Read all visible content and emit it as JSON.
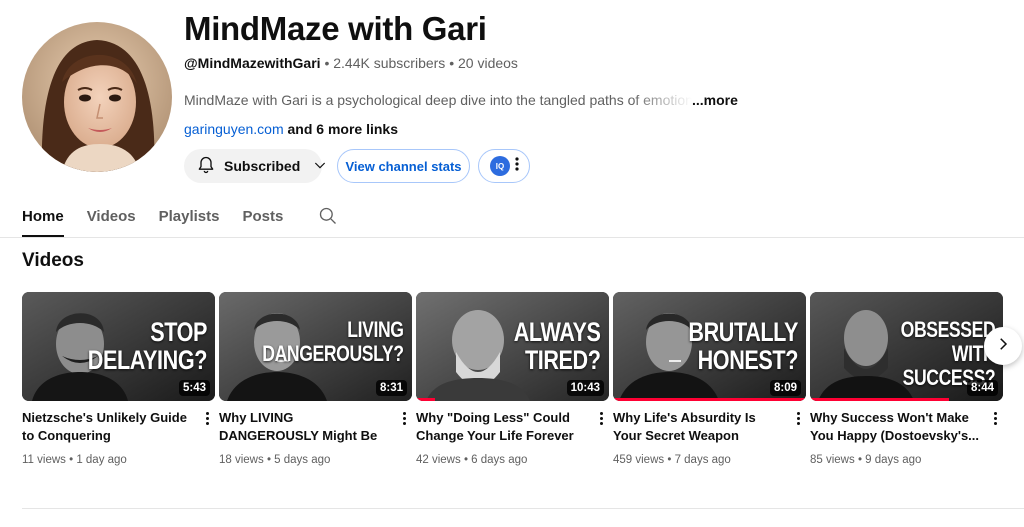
{
  "channel": {
    "name": "MindMaze with Gari",
    "handle": "@MindMazewithGari",
    "separator": " • ",
    "subscribers": "2.44K subscribers",
    "videos_count": "20 videos",
    "description": "MindMaze with Gari is a psychological deep dive into the tangled paths of emotion, identity",
    "description_more": "...more",
    "link": "garinguyen.com",
    "more_links": " and 6 more links"
  },
  "actions": {
    "subscribed_label": "Subscribed",
    "stats_label": "View channel stats",
    "extension_label": "IQ"
  },
  "tabs": [
    {
      "label": "Home",
      "active": true
    },
    {
      "label": "Videos",
      "active": false
    },
    {
      "label": "Playlists",
      "active": false
    },
    {
      "label": "Posts",
      "active": false
    }
  ],
  "section": {
    "title": "Videos"
  },
  "videos": [
    {
      "thumb_text": "STOP\nDELAYING?",
      "duration": "5:43",
      "title": "Nietzsche's Unlikely Guide to Conquering Procrastination",
      "views": "11 views",
      "age": "1 day ago",
      "watched_fraction": 0
    },
    {
      "thumb_text": "LIVING\nDANGEROUSLY?",
      "duration": "8:31",
      "title": "Why LIVING DANGEROUSLY Might Be Key | Camus",
      "views": "18 views",
      "age": "5 days ago",
      "watched_fraction": 0
    },
    {
      "thumb_text": "ALWAYS\nTIRED?",
      "duration": "10:43",
      "title": "Why \"Doing Less\" Could Change Your Life Forever -...",
      "views": "42 views",
      "age": "6 days ago",
      "watched_fraction": 0.1
    },
    {
      "thumb_text": "BRUTALLY\nHONEST?",
      "duration": "8:09",
      "title": "Why Life's Absurdity Is Your Secret Weapon (Camus...",
      "views": "459 views",
      "age": "7 days ago",
      "watched_fraction": 1.0
    },
    {
      "thumb_text": "OBSESSED\nWITH\nSUCCESS?",
      "duration": "8:44",
      "title": "Why Success Won't Make You Happy (Dostoevsky's...",
      "views": "85 views",
      "age": "9 days ago",
      "watched_fraction": 0.72
    }
  ],
  "colors": {
    "link_blue": "#065fd4",
    "progress_red": "#ff0033",
    "text_secondary": "#606060"
  },
  "icons": {
    "bell": "bell-icon",
    "chevron": "chevron-down-icon",
    "search": "search-icon",
    "next": "chevron-right-icon",
    "more": "more-vert-icon"
  }
}
